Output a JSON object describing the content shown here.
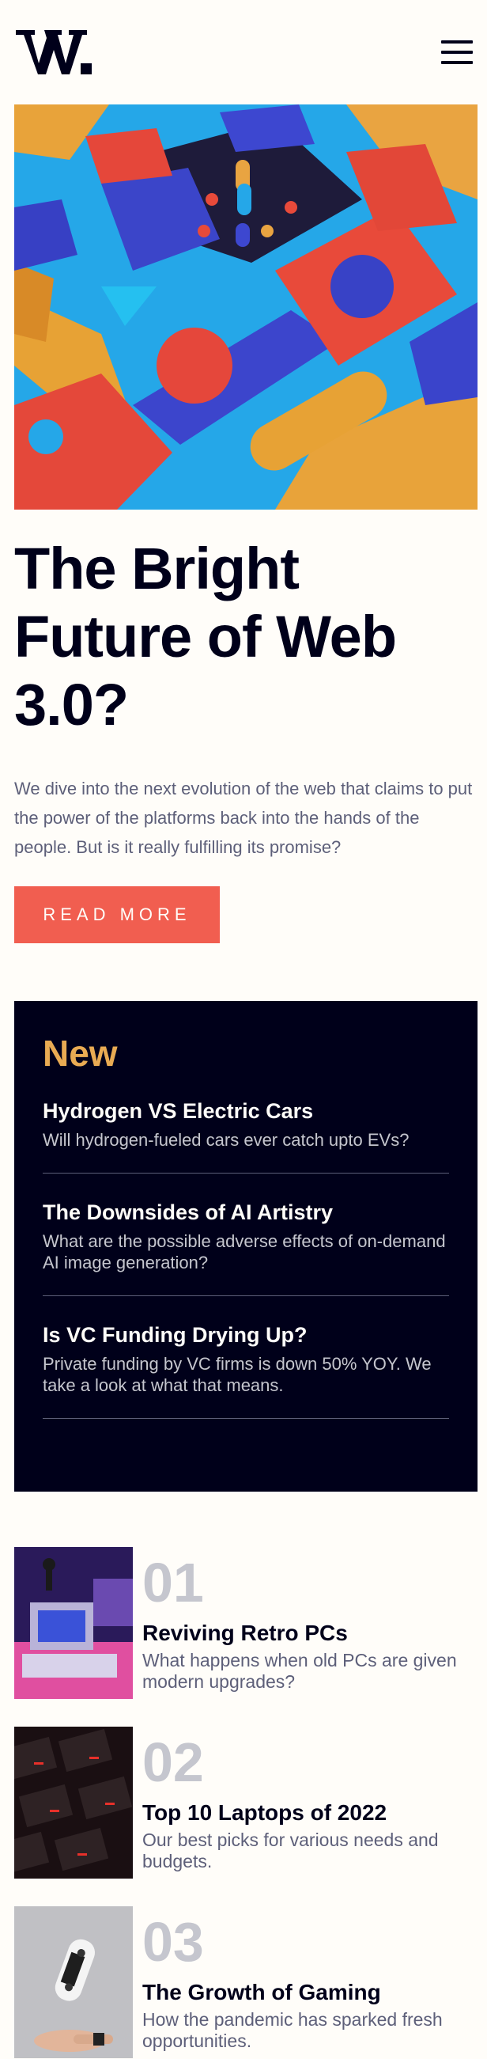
{
  "header": {
    "logo_text": "W.",
    "menu_icon": "hamburger-menu-icon"
  },
  "hero": {
    "image_description_icon": "abstract-3d-blocks-image",
    "headline": "The Bright Future of Web 3.0?",
    "intro": "We dive into the next evolution of the web that claims to put the power of the platforms back into the hands of the people. But is it really fulfilling its promise?",
    "cta_label": "READ MORE"
  },
  "new_panel": {
    "title": "New",
    "items": [
      {
        "title": "Hydrogen VS Electric Cars",
        "desc": "Will hydrogen-fueled cars ever catch upto EVs?"
      },
      {
        "title": "The Downsides of AI Artistry",
        "desc": "What are the possible adverse effects of on-demand AI image generation?"
      },
      {
        "title": "Is VC Funding Drying Up?",
        "desc": "Private funding by VC firms is down 50% YOY. We take a look at what that means."
      }
    ]
  },
  "articles": [
    {
      "num": "01",
      "title": "Reviving Retro PCs",
      "desc": "What happens when old PCs are given modern upgrades?"
    },
    {
      "num": "02",
      "title": "Top 10 Laptops of 2022",
      "desc": "Our best picks for various needs and budgets."
    },
    {
      "num": "03",
      "title": "The Growth of Gaming",
      "desc": "How the pandemic has sparked fresh opportunities."
    }
  ],
  "colors": {
    "accent": "#f15e50",
    "dark": "#00001a",
    "new_title": "#e9ab53",
    "muted": "#5d5f79"
  }
}
